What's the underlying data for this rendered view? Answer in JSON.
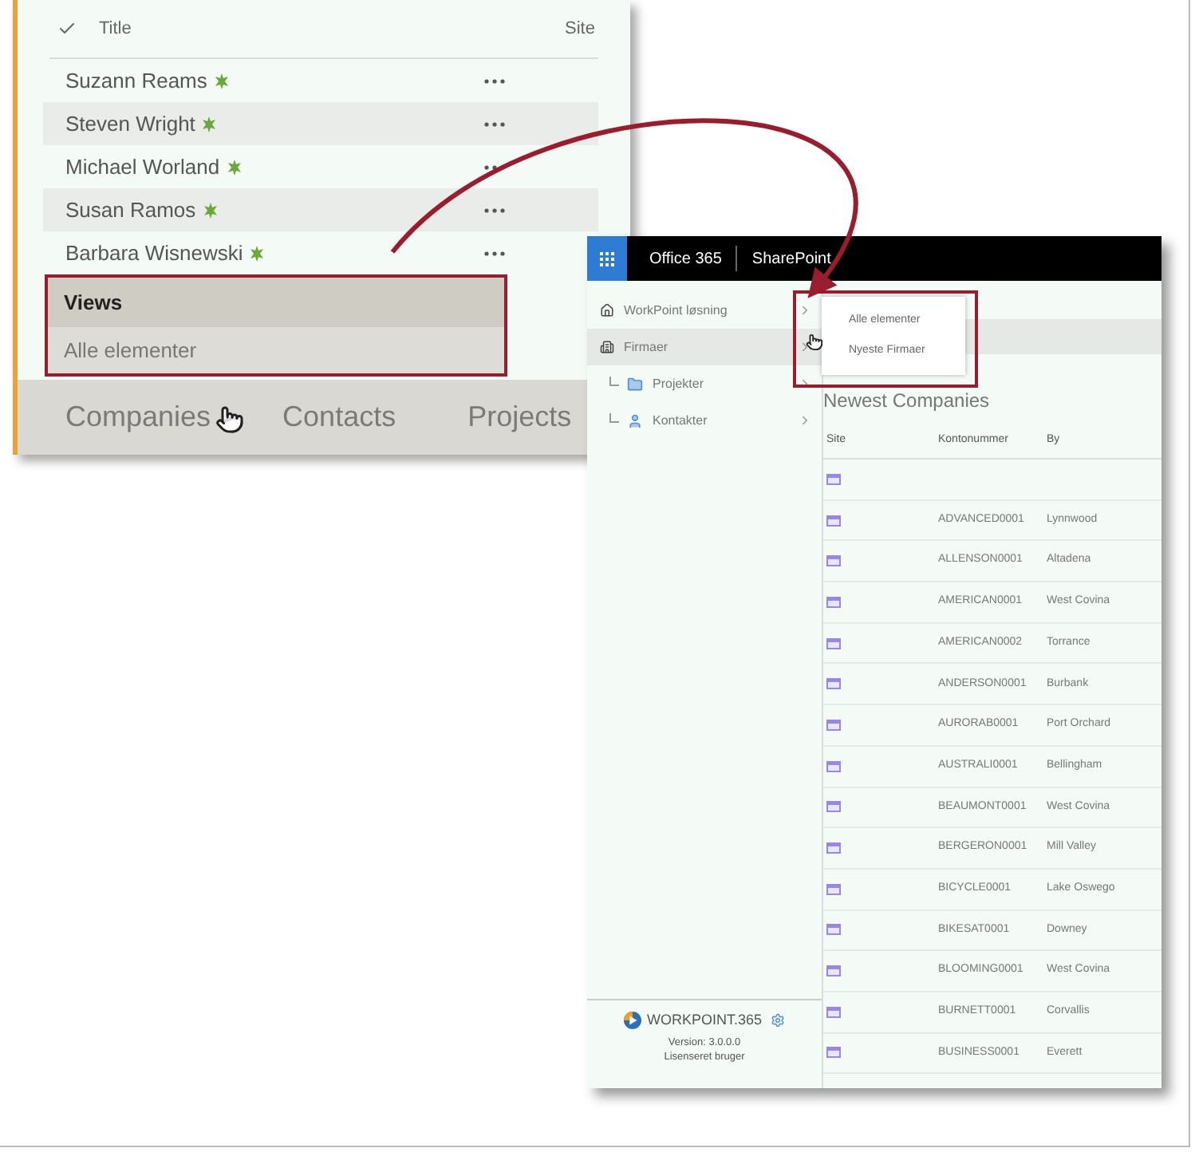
{
  "left_panel": {
    "list": {
      "columns": [
        "Title",
        "Site"
      ],
      "rows": [
        {
          "title": "Suzann Reams"
        },
        {
          "title": "Steven Wright"
        },
        {
          "title": "Michael Worland"
        },
        {
          "title": "Susan Ramos"
        },
        {
          "title": "Barbara Wisnewski"
        }
      ]
    },
    "views_menu": {
      "header": "Views",
      "items": [
        "Alle elementer"
      ]
    },
    "tabs": [
      "Companies",
      "Contacts",
      "Projects"
    ]
  },
  "right_panel": {
    "top_bar": {
      "app": "Office 365",
      "site": "SharePoint"
    },
    "nav": [
      {
        "label": "WorkPoint løsning",
        "selected": false
      },
      {
        "label": "Firmaer",
        "selected": true,
        "children": [
          {
            "label": "Projekter",
            "selected": false
          },
          {
            "label": "Kontakter",
            "selected": false
          }
        ]
      }
    ],
    "dropdown": [
      "Alle elementer",
      "Nyeste Firmaer"
    ],
    "footer": {
      "brand": "WORKPOINT.365",
      "version": "Version: 3.0.0.0",
      "license": "Lisenseret bruger"
    },
    "heading": "Newest Companies",
    "table": {
      "columns": [
        "Site",
        "Kontonummer",
        "By"
      ],
      "rows": [
        {},
        {
          "account": "ADVANCED0001",
          "city": "Lynnwood"
        },
        {
          "account": "ALLENSON0001",
          "city": "Altadena"
        },
        {
          "account": "AMERICAN0001",
          "city": "West Covina"
        },
        {
          "account": "AMERICAN0002",
          "city": "Torrance"
        },
        {
          "account": "ANDERSON0001",
          "city": "Burbank"
        },
        {
          "account": "AURORAB0001",
          "city": "Port Orchard"
        },
        {
          "account": "AUSTRALI0001",
          "city": "Bellingham"
        },
        {
          "account": "BEAUMONT0001",
          "city": "West Covina"
        },
        {
          "account": "BERGERON0001",
          "city": "Mill Valley"
        },
        {
          "account": "BICYCLE0001",
          "city": "Lake Oswego"
        },
        {
          "account": "BIKESAT0001",
          "city": "Downey"
        },
        {
          "account": "BLOOMING0001",
          "city": "West Covina"
        },
        {
          "account": "BURNETT0001",
          "city": "Corvallis"
        },
        {
          "account": "BUSINESS0001",
          "city": "Everett"
        }
      ]
    }
  }
}
